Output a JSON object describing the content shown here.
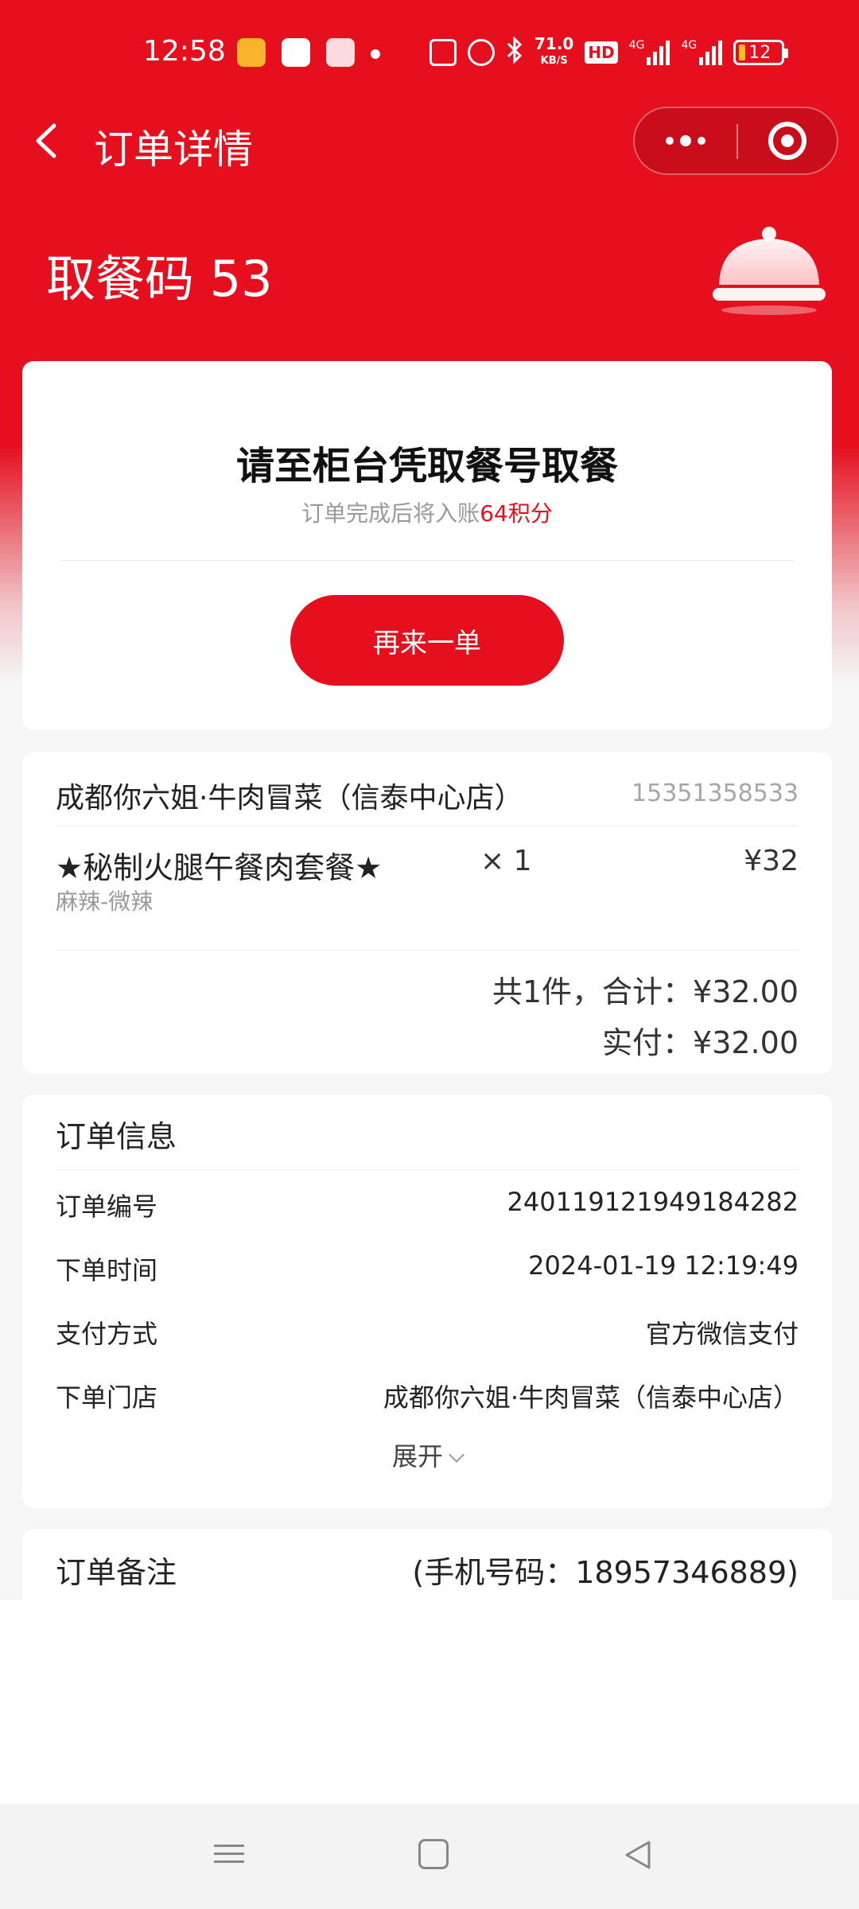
{
  "status_bar": {
    "time": "12:58",
    "speed_value": "71.0",
    "speed_unit": "KB/S",
    "hd_badge": "HD",
    "net1": "4G",
    "net2": "4G",
    "battery": "12"
  },
  "header": {
    "title": "订单详情",
    "pickup_label": "取餐码 53"
  },
  "pickup_card": {
    "heading": "请至柜台凭取餐号取餐",
    "sub_prefix": "订单完成后将入账",
    "sub_points": "64积分",
    "reorder_label": "再来一单"
  },
  "order_card": {
    "store_name": "成都你六姐·牛肉冒菜（信泰中心店）",
    "store_phone": "15351358533",
    "item": {
      "name": "★秘制火腿午餐肉套餐★",
      "spec": "麻辣-微辣",
      "qty": "× 1",
      "price": "¥32"
    },
    "total": "共1件，合计：¥32.00",
    "paid": "实付：¥32.00"
  },
  "info_card": {
    "title": "订单信息",
    "rows": [
      {
        "label": "订单编号",
        "value": "240119121949184282"
      },
      {
        "label": "下单时间",
        "value": "2024-01-19 12:19:49"
      },
      {
        "label": "支付方式",
        "value": "官方微信支付"
      },
      {
        "label": "下单门店",
        "value": "成都你六姐·牛肉冒菜（信泰中心店）"
      }
    ],
    "expand_label": "展开"
  },
  "note_card": {
    "label": "订单备注",
    "value": "(手机号码：18957346889)"
  },
  "colors": {
    "brand_red": "#e50f1e",
    "muted_text": "#999999"
  },
  "icons": [
    "back-arrow-icon",
    "more-dots-icon",
    "close-target-icon",
    "cloche-icon",
    "chevron-down-icon",
    "menu-icon",
    "home-icon",
    "back-triangle-icon"
  ]
}
